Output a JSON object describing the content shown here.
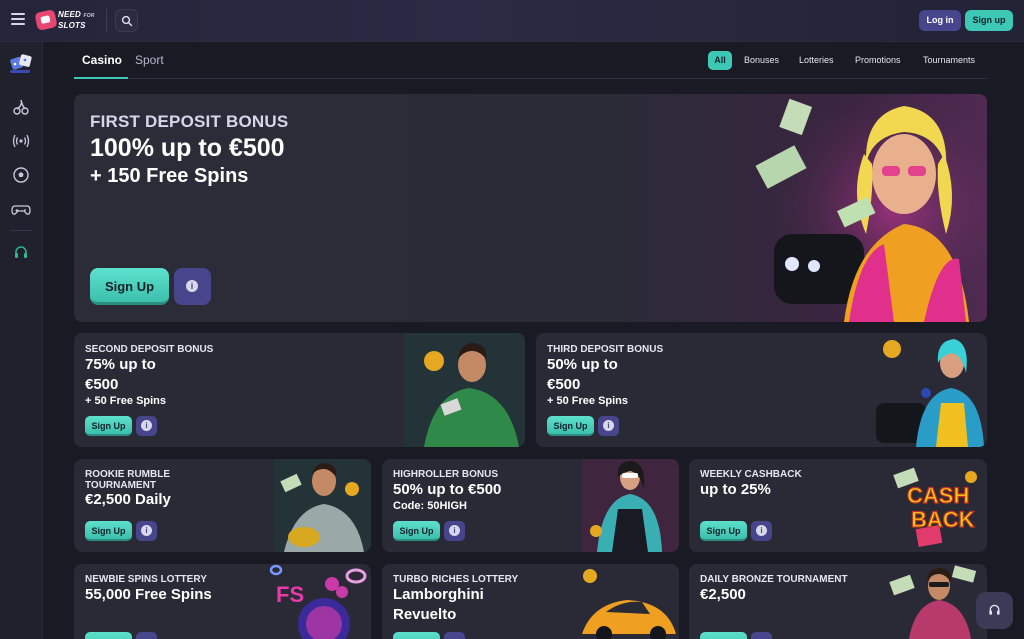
{
  "header": {
    "logo_line1": "NEED",
    "logo_small": "FOR",
    "logo_line2": "SLOTS",
    "login_label": "Log in",
    "signup_label": "Sign up"
  },
  "rail": {
    "icons": [
      "dice-icon",
      "cherry-icon",
      "live-signal-icon",
      "soccer-ball-icon",
      "gamepad-icon",
      "headset-icon"
    ]
  },
  "tabs": {
    "casino": "Casino",
    "sport": "Sport"
  },
  "filters": {
    "all": "All",
    "bonuses": "Bonuses",
    "lotteries": "Lotteries",
    "promotions": "Promotions",
    "tournaments": "Tournaments"
  },
  "hero": {
    "kicker": "FIRST DEPOSIT BONUS",
    "title": "100% up to €500",
    "sub": "+ 150 Free Spins",
    "cta": "Sign Up",
    "info": "i"
  },
  "cards": [
    {
      "kicker": "SECOND DEPOSIT BONUS",
      "title1": "75% up to",
      "title2": "€500",
      "sub": "+ 50 Free Spins",
      "cta": "Sign Up",
      "info": "i"
    },
    {
      "kicker": "THIRD DEPOSIT BONUS",
      "title1": "50% up to",
      "title2": "€500",
      "sub": "+ 50 Free Spins",
      "cta": "Sign Up",
      "info": "i"
    },
    {
      "kicker1": "ROOKIE RUMBLE",
      "kicker2": "TOURNAMENT",
      "title": "€2,500 Daily",
      "cta": "Sign Up",
      "info": "i"
    },
    {
      "kicker": "HIGHROLLER BONUS",
      "title": "50% up to €500",
      "sub": "Code: 50HIGH",
      "cta": "Sign Up",
      "info": "i"
    },
    {
      "kicker": "WEEKLY CASHBACK",
      "title": "up to 25%",
      "art_text1": "CASH",
      "art_text2": "BACK",
      "cta": "Sign Up",
      "info": "i"
    },
    {
      "kicker": "NEWBIE SPINS LOTTERY",
      "title": "55,000 Free Spins",
      "art_text": "FS"
    },
    {
      "kicker": "TURBO RICHES LOTTERY",
      "title1": "Lamborghini",
      "title2": "Revuelto"
    },
    {
      "kicker": "DAILY BRONZE TOURNAMENT",
      "title": "€2,500"
    }
  ],
  "colors": {
    "accent": "#3cc8b4",
    "secondary": "#47458c",
    "background": "#1a1a24",
    "card": "#2a2a36"
  }
}
